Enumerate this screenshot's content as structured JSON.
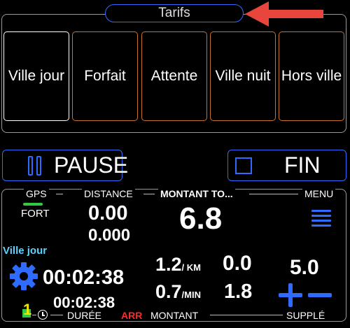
{
  "tarifs": {
    "title": "Tarifs",
    "items": [
      {
        "label": "Ville jour"
      },
      {
        "label": "Forfait"
      },
      {
        "label": "Attente"
      },
      {
        "label": "Ville nuit"
      },
      {
        "label": "Hors ville"
      }
    ]
  },
  "controls": {
    "pause_label": "PAUSE",
    "fin_label": "FIN"
  },
  "meter": {
    "gps_label": "GPS",
    "gps_signal": "FORT",
    "distance_label": "DISTANCE",
    "distance_value": "0.00",
    "distance_value2": "0.000",
    "montant_total_label": "MONTANT TO...",
    "montant_total_value": "6.8",
    "menu_label": "MENU",
    "tarif_current": "Ville jour",
    "timer_main": "00:02:38",
    "timer_secondary": "00:02:38",
    "rate_km": "1.2",
    "rate_km_unit": "/ KM",
    "rate_min": "0.7",
    "rate_min_unit": "/MIN",
    "value_km": "0.0",
    "value_min": "1.8",
    "supplement_value": "5.0",
    "counter_badge": "1",
    "duree_label": "DURÉE",
    "arr_label": "ARR",
    "montant_label": "MONTANT",
    "supple_label": "SUPPLÉ"
  },
  "colors": {
    "accent_blue": "#2f6bff",
    "tile_border": "#c8732b",
    "gps_green": "#2ecc40",
    "tarif_cyan": "#5fd3ff",
    "arr_red": "#ff2a2a",
    "arrow_red": "#e8453c",
    "badge_yellow": "#f2e600"
  }
}
